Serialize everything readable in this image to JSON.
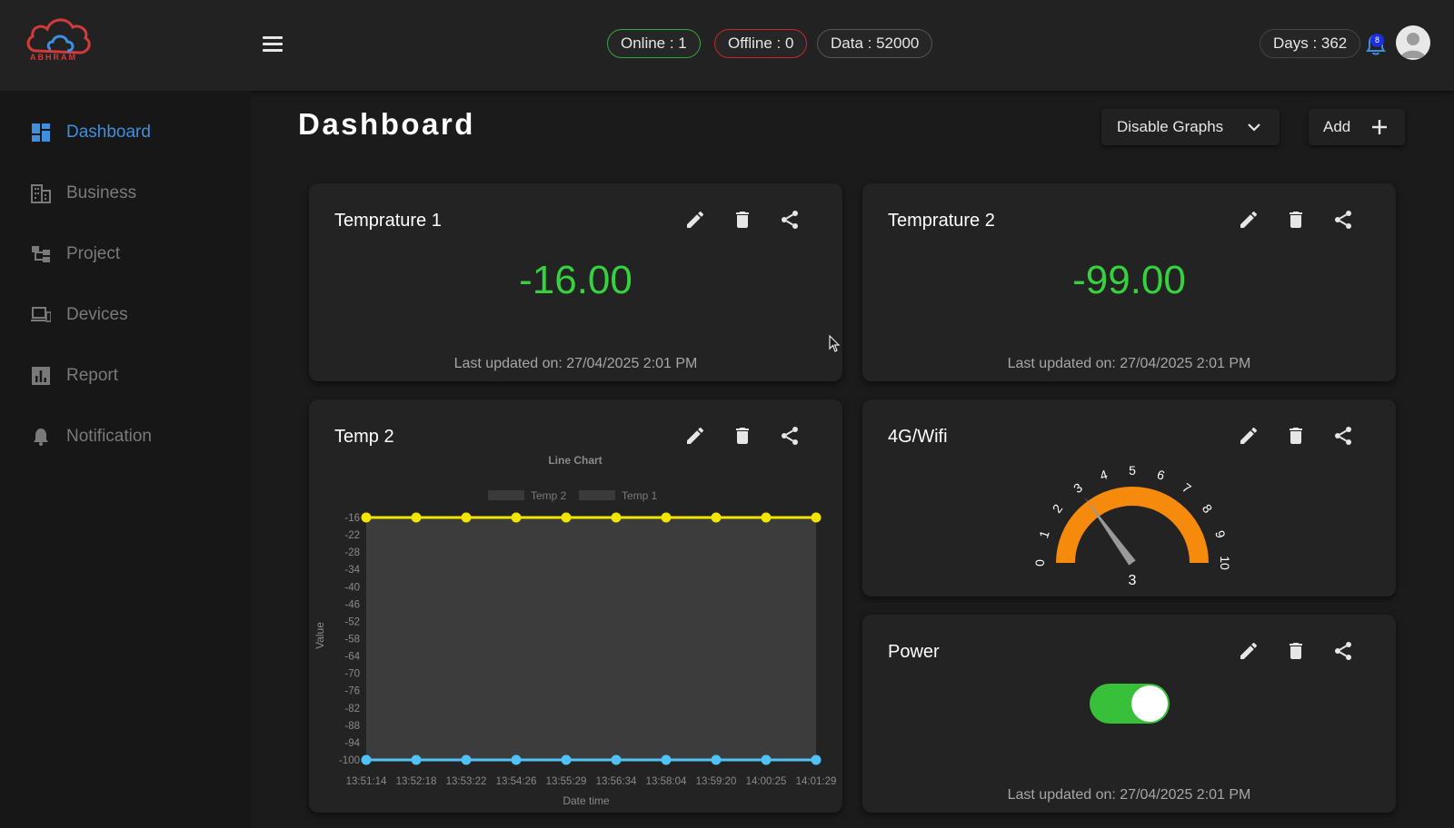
{
  "brand": {
    "name": "ABHRAM"
  },
  "header": {
    "online_label": "Online  : 1",
    "offline_label": "Offline : 0",
    "data_label": "Data : 52000",
    "days_label": "Days : 362",
    "notification_count": "8"
  },
  "sidebar": {
    "items": [
      {
        "label": "Dashboard",
        "icon": "dashboard-icon",
        "active": true
      },
      {
        "label": "Business",
        "icon": "building-icon",
        "active": false
      },
      {
        "label": "Project",
        "icon": "project-tree-icon",
        "active": false
      },
      {
        "label": "Devices",
        "icon": "devices-icon",
        "active": false
      },
      {
        "label": "Report",
        "icon": "bar-report-icon",
        "active": false
      },
      {
        "label": "Notification",
        "icon": "bell-icon",
        "active": false
      }
    ]
  },
  "main": {
    "title": "Dashboard",
    "disable_graphs_label": "Disable Graphs",
    "add_label": "Add"
  },
  "widgets": {
    "temp1": {
      "title": "Temprature 1",
      "value": "-16.00",
      "updated": "Last updated on: 27/04/2025 2:01 PM"
    },
    "temp2": {
      "title": "Temprature 2",
      "value": "-99.00",
      "updated": "Last updated on: 27/04/2025 2:01 PM"
    },
    "chart": {
      "title": "Temp 2"
    },
    "gauge": {
      "title": "4G/Wifi",
      "value": 3,
      "min": 0,
      "max": 10,
      "ticks": [
        "0",
        "1",
        "2",
        "3",
        "4",
        "5",
        "6",
        "7",
        "8",
        "9",
        "10"
      ],
      "value_label": "3"
    },
    "power": {
      "title": "Power",
      "state": "on",
      "updated": "Last updated on: 27/04/2025 2:01 PM"
    }
  },
  "chart_data": {
    "type": "line",
    "title": "Line Chart",
    "xlabel": "Date time",
    "ylabel": "Value",
    "categories": [
      "13:51:14",
      "13:52:18",
      "13:53:22",
      "13:54:26",
      "13:55:29",
      "13:56:34",
      "13:58:04",
      "13:59:20",
      "14:00:25",
      "14:01:29"
    ],
    "yticks": [
      "-16",
      "-22",
      "-28",
      "-34",
      "-40",
      "-46",
      "-52",
      "-58",
      "-64",
      "-70",
      "-76",
      "-82",
      "-88",
      "-94",
      "-100"
    ],
    "ylim": [
      -100,
      -16
    ],
    "legend": "top",
    "series": [
      {
        "name": "Temp 2",
        "color": "#4fc3f7",
        "values": [
          -100,
          -100,
          -100,
          -100,
          -100,
          -100,
          -100,
          -100,
          -100,
          -100
        ]
      },
      {
        "name": "Temp 1",
        "color": "#f2e500",
        "values": [
          -16,
          -16,
          -16,
          -16,
          -16,
          -16,
          -16,
          -16,
          -16,
          -16
        ]
      }
    ]
  },
  "colors": {
    "accent": "#3f8fdc",
    "value_green": "#36d13e",
    "online": "#2fa83a",
    "offline": "#c9262a",
    "gauge": "#f68a0c",
    "toggle": "#38c03a"
  }
}
